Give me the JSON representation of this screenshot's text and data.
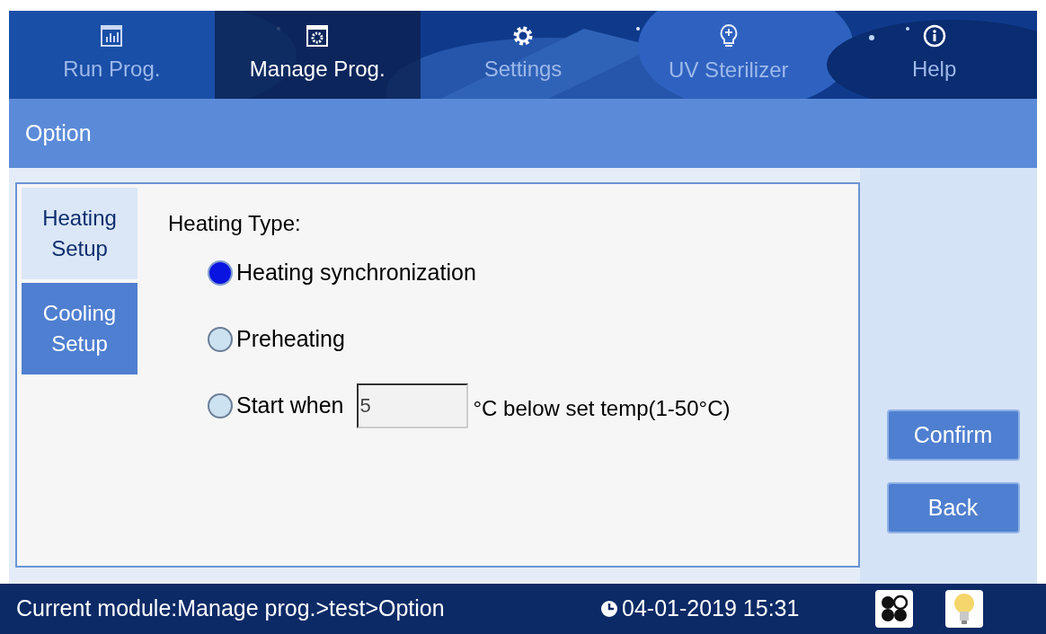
{
  "nav_tabs": [
    {
      "label": "Run Prog.",
      "selected": false
    },
    {
      "label": "Manage Prog.",
      "selected": true
    },
    {
      "label": "Settings",
      "selected": false
    },
    {
      "label": "UV Sterilizer",
      "selected": false
    },
    {
      "label": "Help",
      "selected": false
    }
  ],
  "section_title": "Option",
  "side_tabs": [
    {
      "label": "Heating Setup",
      "selected": true
    },
    {
      "label": "Cooling Setup",
      "selected": false
    }
  ],
  "heading": "Heating Type:",
  "options": [
    {
      "kind": "plain",
      "label": "Heating synchronization",
      "selected": true
    },
    {
      "kind": "plain",
      "label": "Preheating",
      "selected": false
    },
    {
      "kind": "input",
      "label": "Start when",
      "value": "5",
      "suffix": "°C below set temp(1-50°C)",
      "selected": false
    }
  ],
  "buttons": [
    "Confirm",
    "Back"
  ],
  "status_bar": {
    "module": "Current module:Manage prog.>test>Option",
    "datetime": "04-01-2019 15:31"
  }
}
